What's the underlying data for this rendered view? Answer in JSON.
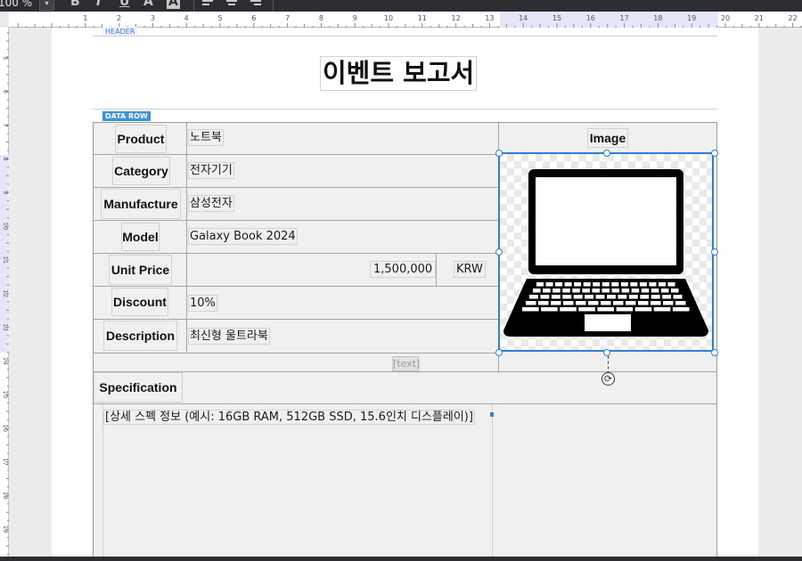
{
  "toolbar": {
    "zoom_value": "100 %",
    "zoom_dropdown": "▾",
    "bold": "B",
    "italic": "I",
    "underline": "U",
    "text_color": "A",
    "fill": "A"
  },
  "ruler": {
    "top_numbers": [
      "1",
      "2",
      "3",
      "4",
      "5",
      "6",
      "7",
      "8",
      "9",
      "10",
      "11",
      "12",
      "13",
      "14",
      "15",
      "16",
      "17",
      "18",
      "19",
      "20",
      "21",
      "22"
    ],
    "left_numbers": [
      "5",
      "6",
      "7",
      "8",
      "9",
      "10",
      "11",
      "12",
      "13",
      "14",
      "15",
      "16",
      "17",
      "18",
      "19"
    ]
  },
  "bands": {
    "header_label": "HEADER",
    "data_row_label": "DATA ROW"
  },
  "report": {
    "title": "이벤트 보고서"
  },
  "fields": {
    "product": {
      "label": "Product",
      "value": "노트북"
    },
    "category": {
      "label": "Category",
      "value": "전자기기"
    },
    "manufacture": {
      "label": "Manufacture",
      "value": "삼성전자"
    },
    "model": {
      "label": "Model",
      "value": "Galaxy Book 2024"
    },
    "unit_price": {
      "label": "Unit Price",
      "value": "1,500,000",
      "currency": "KRW"
    },
    "discount": {
      "label": "Discount",
      "value": "10%"
    },
    "description": {
      "label": "Description",
      "value": "최신형 울트라북"
    },
    "image": {
      "label": "Image",
      "icon": "laptop-icon"
    },
    "specification": {
      "label": "Specification",
      "value": "[상세 스펙 정보 (예시: 16GB RAM, 512GB SSD, 15.6인치 디스플레이)]"
    }
  },
  "placeholder_text": "[text]",
  "colors": {
    "selection": "#2f7fd8",
    "data_row_badge": "#3b93e0",
    "toolbar_bg": "#2b2d31"
  }
}
